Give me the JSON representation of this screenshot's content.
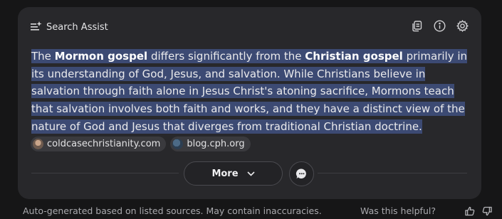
{
  "header": {
    "title": "Search Assist",
    "icons": [
      "sparkle-list-icon",
      "copy-icon",
      "info-icon",
      "gear-icon"
    ]
  },
  "answer": {
    "p1": "The ",
    "b1": "Mormon gospel",
    "p2": " differs significantly from the ",
    "b2": "Christian gospel",
    "p3": " primarily in its understanding of God, Jesus, and salvation. While Christians believe in salvation through faith alone in Jesus Christ's atoning sacrifice, Mormons teach that salvation involves both faith and works, and they have a distinct view of the nature of God and Jesus that diverges from traditional Christian doctrine."
  },
  "sources": [
    {
      "label": "coldcasechristianity.com"
    },
    {
      "label": "blog.cph.org"
    }
  ],
  "more_label": "More",
  "footer": {
    "disclaimer": "Auto-generated based on listed sources. May contain inaccuracies.",
    "helpful": "Was this helpful?"
  },
  "colors": {
    "highlight": "#3c4a73",
    "card": "#28282b",
    "background": "#161617"
  }
}
